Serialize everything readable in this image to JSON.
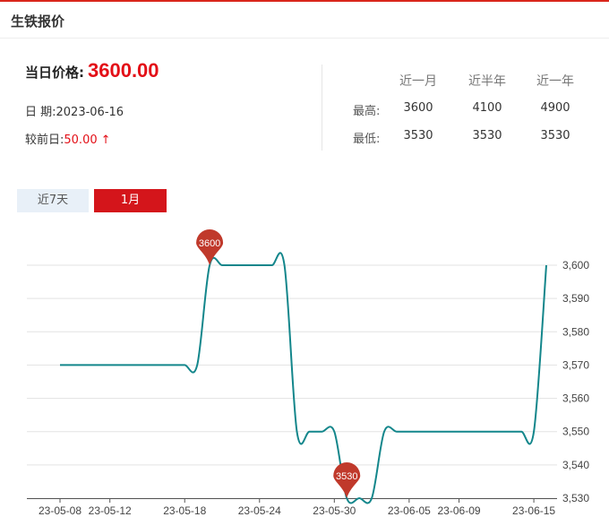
{
  "header": {
    "title": "生铁报价"
  },
  "summary": {
    "price_label": "当日价格:",
    "price_value": "3600.00",
    "date_label": "日 期:",
    "date_value": "2023-06-16",
    "change_label": "较前日:",
    "change_value": "50.00",
    "change_arrow": "↑"
  },
  "stats": {
    "columns": [
      "近一月",
      "近半年",
      "近一年"
    ],
    "high_label": "最高:",
    "low_label": "最低:",
    "high": [
      "3600",
      "4100",
      "4900"
    ],
    "low": [
      "3530",
      "3530",
      "3530"
    ]
  },
  "tabs": [
    {
      "label": "近7天"
    },
    {
      "label": "1月",
      "active": true
    }
  ],
  "colors": {
    "accent": "#d4151b",
    "line": "#13868b",
    "marker": "#c0392b"
  },
  "chart_data": {
    "type": "line",
    "x": [
      "23-05-08",
      "23-05-09",
      "23-05-10",
      "23-05-11",
      "23-05-12",
      "23-05-13",
      "23-05-14",
      "23-05-15",
      "23-05-16",
      "23-05-17",
      "23-05-18",
      "23-05-19",
      "23-05-20",
      "23-05-21",
      "23-05-22",
      "23-05-23",
      "23-05-24",
      "23-05-25",
      "23-05-26",
      "23-05-27",
      "23-05-28",
      "23-05-29",
      "23-05-30",
      "23-05-31",
      "23-06-01",
      "23-06-02",
      "23-06-03",
      "23-06-04",
      "23-06-05",
      "23-06-06",
      "23-06-07",
      "23-06-08",
      "23-06-09",
      "23-06-10",
      "23-06-11",
      "23-06-12",
      "23-06-13",
      "23-06-14",
      "23-06-15",
      "23-06-16"
    ],
    "series": [
      {
        "values": [
          3570,
          3570,
          3570,
          3570,
          3570,
          3570,
          3570,
          3570,
          3570,
          3570,
          3570,
          3570,
          3600,
          3600,
          3600,
          3600,
          3600,
          3600,
          3600,
          3550,
          3550,
          3550,
          3550,
          3530,
          3530,
          3530,
          3550,
          3550,
          3550,
          3550,
          3550,
          3550,
          3550,
          3550,
          3550,
          3550,
          3550,
          3550,
          3550,
          3600
        ]
      }
    ],
    "xticks": [
      "23-05-08",
      "23-05-12",
      "23-05-18",
      "23-05-24",
      "23-05-30",
      "23-06-05",
      "23-06-09",
      "23-06-15"
    ],
    "yticks": [
      "3,530",
      "3,540",
      "3,550",
      "3,560",
      "3,570",
      "3,580",
      "3,590",
      "3,600"
    ],
    "ylim": [
      3530,
      3600
    ],
    "grid": true,
    "markers": [
      {
        "label": "3600",
        "x": "23-05-20",
        "y": 3600
      },
      {
        "label": "3530",
        "x": "23-05-31",
        "y": 3530
      }
    ]
  }
}
